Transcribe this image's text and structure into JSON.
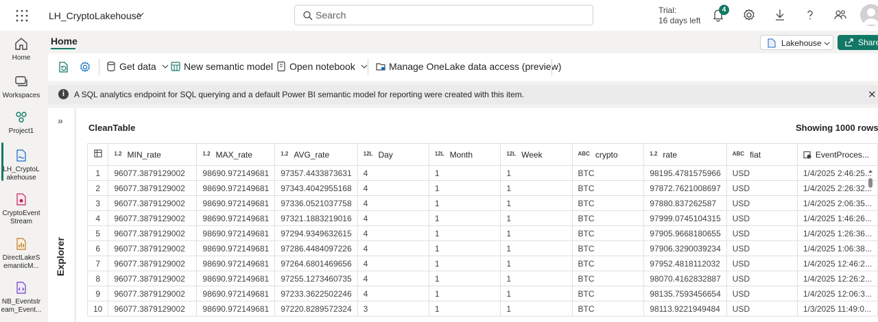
{
  "header": {
    "app_title": "LH_CryptoLakehouse",
    "search_placeholder": "Search",
    "trial_line1": "Trial:",
    "trial_line2": "16 days left",
    "notification_count": "4"
  },
  "rail": {
    "items": [
      {
        "label": "Home",
        "icon": "home-icon"
      },
      {
        "label": "Workspaces",
        "icon": "workspaces-icon"
      },
      {
        "label": "Project1",
        "icon": "project-icon"
      },
      {
        "label": "LH_CryptoLakehouse",
        "line1": "LH_CryptoL",
        "line2": "akehouse",
        "icon": "lakehouse-icon"
      },
      {
        "label": "CryptoEventStream",
        "line1": "CryptoEvent",
        "line2": "Stream",
        "icon": "eventstream-icon"
      },
      {
        "label": "DirectLakeSemanticM...",
        "line1": "DirectLakeS",
        "line2": "emanticM...",
        "icon": "semantic-model-icon"
      },
      {
        "label": "NB_Eventstream_Event...",
        "line1": "NB_Eventstr",
        "line2": "eam_Event...",
        "icon": "notebook-icon"
      }
    ]
  },
  "ribbon": {
    "tab": "Home",
    "lakehouse_switch": "Lakehouse",
    "share": "Share",
    "get_data": "Get data",
    "new_semantic_model": "New semantic model",
    "open_notebook": "Open notebook",
    "manage_access": "Manage OneLake data access (preview)"
  },
  "banner": {
    "text": "A SQL analytics endpoint for SQL querying and a default Power BI semantic model for reporting were created with this item."
  },
  "explorer": {
    "label": "Explorer"
  },
  "table": {
    "title": "CleanTable",
    "row_count": "Showing 1000 rows",
    "columns": [
      {
        "type": "1.2",
        "name": "MIN_rate"
      },
      {
        "type": "1.2",
        "name": "MAX_rate"
      },
      {
        "type": "1.2",
        "name": "AVG_rate"
      },
      {
        "type": "12L",
        "name": "Day"
      },
      {
        "type": "12L",
        "name": "Month"
      },
      {
        "type": "12L",
        "name": "Week"
      },
      {
        "type": "ABC",
        "name": "crypto"
      },
      {
        "type": "1.2",
        "name": "rate"
      },
      {
        "type": "ABC",
        "name": "fiat"
      },
      {
        "type": "clock",
        "name": "EventProces..."
      }
    ],
    "rows": [
      [
        "1",
        "96077.3879129002",
        "98690.972149681",
        "97357.4433873631",
        "4",
        "1",
        "1",
        "BTC",
        "98195.4781575966",
        "USD",
        "1/4/2025 2:46:25..."
      ],
      [
        "2",
        "96077.3879129002",
        "98690.972149681",
        "97343.4042955168",
        "4",
        "1",
        "1",
        "BTC",
        "97872.7621008697",
        "USD",
        "1/4/2025 2:26:32..."
      ],
      [
        "3",
        "96077.3879129002",
        "98690.972149681",
        "97336.0521037758",
        "4",
        "1",
        "1",
        "BTC",
        "97880.837262587",
        "USD",
        "1/4/2025 2:06:35..."
      ],
      [
        "4",
        "96077.3879129002",
        "98690.972149681",
        "97321.1883219016",
        "4",
        "1",
        "1",
        "BTC",
        "97999.0745104315",
        "USD",
        "1/4/2025 1:46:26..."
      ],
      [
        "5",
        "96077.3879129002",
        "98690.972149681",
        "97294.9349632615",
        "4",
        "1",
        "1",
        "BTC",
        "97905.9668180655",
        "USD",
        "1/4/2025 1:26:36..."
      ],
      [
        "6",
        "96077.3879129002",
        "98690.972149681",
        "97286.4484097226",
        "4",
        "1",
        "1",
        "BTC",
        "97906.3290039234",
        "USD",
        "1/4/2025 1:06:38..."
      ],
      [
        "7",
        "96077.3879129002",
        "98690.972149681",
        "97264.6801469656",
        "4",
        "1",
        "1",
        "BTC",
        "97952.4818112032",
        "USD",
        "1/4/2025 12:46:2..."
      ],
      [
        "8",
        "96077.3879129002",
        "98690.972149681",
        "97255.1273460735",
        "4",
        "1",
        "1",
        "BTC",
        "98070.4162832887",
        "USD",
        "1/4/2025 12:26:2..."
      ],
      [
        "9",
        "96077.3879129002",
        "98690.972149681",
        "97233.3622502246",
        "4",
        "1",
        "1",
        "BTC",
        "98135.7593456654",
        "USD",
        "1/4/2025 12:06:3..."
      ],
      [
        "10",
        "96077.3879129002",
        "98690.972149681",
        "97220.8289572324",
        "3",
        "1",
        "1",
        "BTC",
        "98113.9221949484",
        "USD",
        "1/3/2025 11:49:0..."
      ]
    ]
  },
  "colors": {
    "accent": "#117865"
  }
}
